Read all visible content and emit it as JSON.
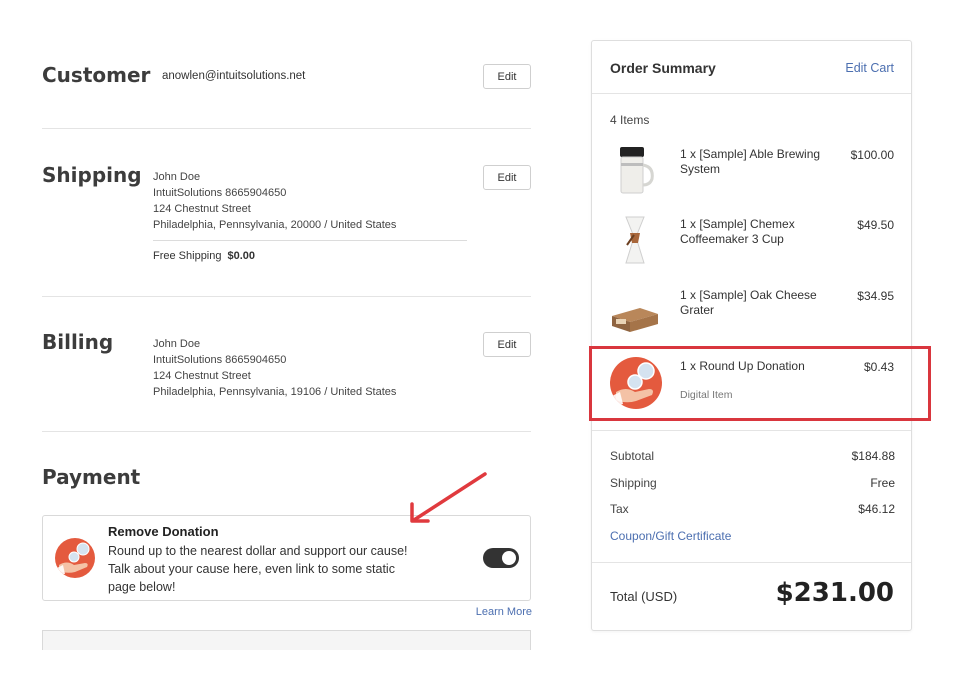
{
  "customer": {
    "title": "Customer",
    "email": "anowlen@intuitsolutions.net",
    "edit_label": "Edit"
  },
  "shipping": {
    "title": "Shipping",
    "name": "John Doe",
    "company_phone": "IntuitSolutions 8665904650",
    "street": "124 Chestnut Street",
    "city_line": "Philadelphia, Pennsylvania, 20000 / United States",
    "method_label": "Free Shipping",
    "method_price": "$0.00",
    "edit_label": "Edit"
  },
  "billing": {
    "title": "Billing",
    "name": "John Doe",
    "company_phone": "IntuitSolutions 8665904650",
    "street": "124 Chestnut Street",
    "city_line": "Philadelphia, Pennsylvania, 19106 / United States",
    "edit_label": "Edit"
  },
  "payment": {
    "title": "Payment",
    "donation_title": "Remove Donation",
    "donation_text": "Round up to the nearest dollar and support our cause! Talk about your cause here, even link to some static page below!",
    "toggle_on": true,
    "learn_more": "Learn More"
  },
  "summary": {
    "title": "Order Summary",
    "edit_cart": "Edit Cart",
    "items_count": "4 Items",
    "items": [
      {
        "name": "1 x [Sample] Able Brewing System",
        "sub": "",
        "price": "$100.00",
        "thumb": "brewing-system-icon"
      },
      {
        "name": "1 x [Sample] Chemex Coffeemaker 3 Cup",
        "sub": "",
        "price": "$49.50",
        "thumb": "chemex-icon"
      },
      {
        "name": "1 x [Sample] Oak Cheese Grater",
        "sub": "",
        "price": "$34.95",
        "thumb": "cheese-grater-icon"
      },
      {
        "name": "1 x Round Up Donation",
        "sub": "Digital Item",
        "price": "$0.43",
        "thumb": "donation-icon"
      }
    ],
    "subtotal_label": "Subtotal",
    "subtotal": "$184.88",
    "shipping_label": "Shipping",
    "shipping": "Free",
    "tax_label": "Tax",
    "tax": "$46.12",
    "coupon_label": "Coupon/Gift Certificate",
    "total_label": "Total (USD)",
    "total": "$231.00"
  },
  "colors": {
    "link": "#4c6fb0",
    "highlight": "#d9363e",
    "donation_icon": "#e45a3e"
  }
}
